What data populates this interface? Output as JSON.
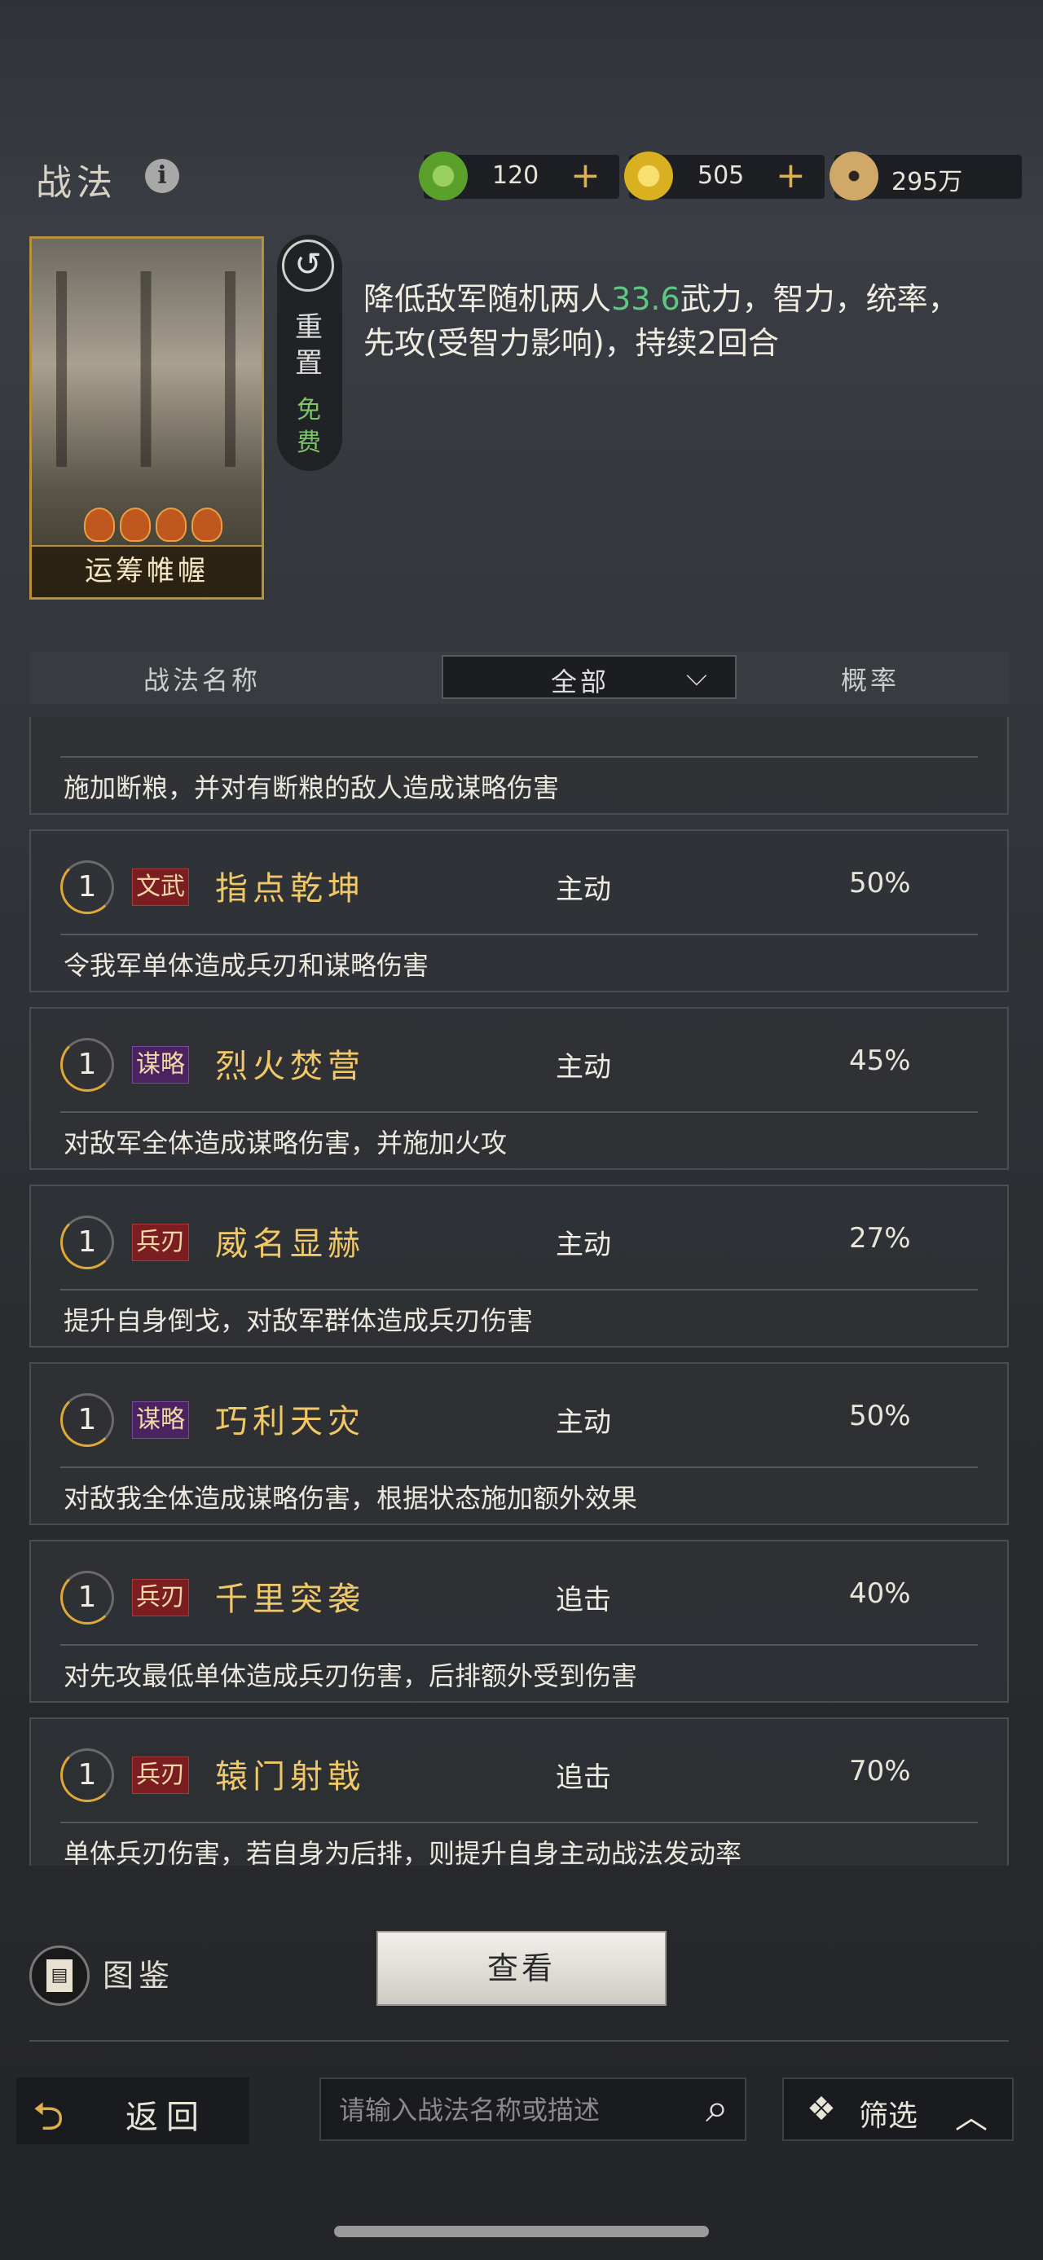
{
  "header": {
    "title": "战法",
    "info_icon": "i"
  },
  "currencies": [
    {
      "icon": "jade-coin-icon",
      "value": "120",
      "plus": "+",
      "color": "#5aa02a"
    },
    {
      "icon": "gold-coin-icon",
      "value": "505",
      "plus": "+",
      "color": "#d8b020"
    },
    {
      "icon": "copper-coin-icon",
      "value": "295万",
      "color": "#b08848"
    }
  ],
  "featured": {
    "card_name": "运筹帷幄",
    "reset_label": "重置",
    "free_label": "免费",
    "desc_before": "降低敌军随机两人",
    "desc_highlight": "33.6",
    "desc_after": "武力，智力，统率，先攻(受智力影响)，持续2回合"
  },
  "list_header": {
    "name_col": "战法名称",
    "filter_value": "全部",
    "rate_col": "概率"
  },
  "partial_row": {
    "desc": "施加断粮，并对有断粮的敌人造成谋略伤害"
  },
  "rows": [
    {
      "level": "1",
      "tag": "文武",
      "tag_color": "red",
      "name": "指点乾坤",
      "type": "主动",
      "rate": "50%",
      "desc": "令我军单体造成兵刃和谋略伤害"
    },
    {
      "level": "1",
      "tag": "谋略",
      "tag_color": "purple",
      "name": "烈火焚营",
      "type": "主动",
      "rate": "45%",
      "desc": "对敌军全体造成谋略伤害，并施加火攻"
    },
    {
      "level": "1",
      "tag": "兵刃",
      "tag_color": "red",
      "name": "威名显赫",
      "type": "主动",
      "rate": "27%",
      "desc": "提升自身倒戈，对敌军群体造成兵刃伤害"
    },
    {
      "level": "1",
      "tag": "谋略",
      "tag_color": "purple",
      "name": "巧利天灾",
      "type": "主动",
      "rate": "50%",
      "desc": "对敌我全体造成谋略伤害，根据状态施加额外效果"
    },
    {
      "level": "1",
      "tag": "兵刃",
      "tag_color": "red",
      "name": "千里突袭",
      "type": "追击",
      "rate": "40%",
      "desc": "对先攻最低单体造成兵刃伤害，后排额外受到伤害"
    },
    {
      "level": "1",
      "tag": "兵刃",
      "tag_color": "red",
      "name": "辕门射戟",
      "type": "追击",
      "rate": "70%",
      "desc": "单体兵刃伤害，若自身为后排，则提升自身主动战法发动率"
    }
  ],
  "footer": {
    "atlas_label": "图鉴",
    "view_button": "查看",
    "back_label": "返回",
    "search_placeholder": "请输入战法名称或描述",
    "filter_label": "筛选"
  }
}
